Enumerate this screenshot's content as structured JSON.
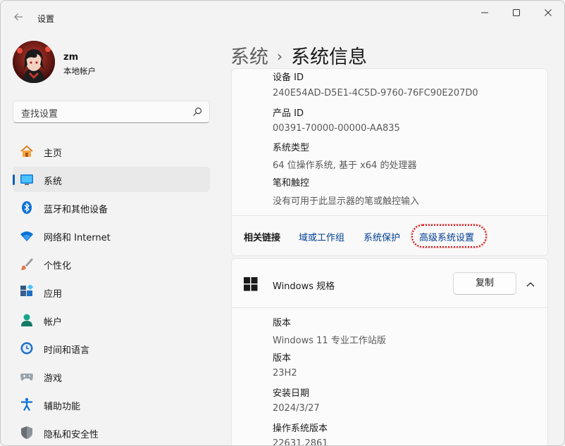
{
  "window": {
    "title": "设置"
  },
  "profile": {
    "username": "zm",
    "account_type": "本地帐户"
  },
  "search": {
    "placeholder": "查找设置"
  },
  "nav": [
    {
      "label": "主页",
      "icon": "home-icon"
    },
    {
      "label": "系统",
      "icon": "system-icon",
      "active": true
    },
    {
      "label": "蓝牙和其他设备",
      "icon": "bluetooth-icon"
    },
    {
      "label": "网络和 Internet",
      "icon": "wifi-icon"
    },
    {
      "label": "个性化",
      "icon": "brush-icon"
    },
    {
      "label": "应用",
      "icon": "apps-icon"
    },
    {
      "label": "帐户",
      "icon": "account-icon"
    },
    {
      "label": "时间和语言",
      "icon": "time-language-icon"
    },
    {
      "label": "游戏",
      "icon": "gaming-icon"
    },
    {
      "label": "辅助功能",
      "icon": "accessibility-icon"
    },
    {
      "label": "隐私和安全性",
      "icon": "shield-icon"
    }
  ],
  "breadcrumb": {
    "parent": "系统",
    "separator": "›",
    "current": "系统信息"
  },
  "device_specs": [
    {
      "label": "设备 ID",
      "value": "240E54AD-D5E1-4C5D-9760-76FC90E207D0"
    },
    {
      "label": "产品 ID",
      "value": "00391-70000-00000-AA835"
    },
    {
      "label": "系统类型",
      "value": "64 位操作系统, 基于 x64 的处理器"
    },
    {
      "label": "笔和触控",
      "value": "没有可用于此显示器的笔或触控输入"
    }
  ],
  "related_links": {
    "title": "相关链接",
    "links": [
      "域或工作组",
      "系统保护",
      "高级系统设置"
    ]
  },
  "windows_specs": {
    "title": "Windows 规格",
    "copy_label": "复制",
    "items": [
      {
        "label": "版本",
        "value": "Windows 11 专业工作站版"
      },
      {
        "label": "版本",
        "value": "23H2"
      },
      {
        "label": "安装日期",
        "value": "2024/3/27"
      },
      {
        "label": "操作系统版本",
        "value": "22631.2861"
      }
    ]
  },
  "colors": {
    "accent": "#005fb8",
    "link": "#003e92",
    "highlight": "#d01010"
  }
}
